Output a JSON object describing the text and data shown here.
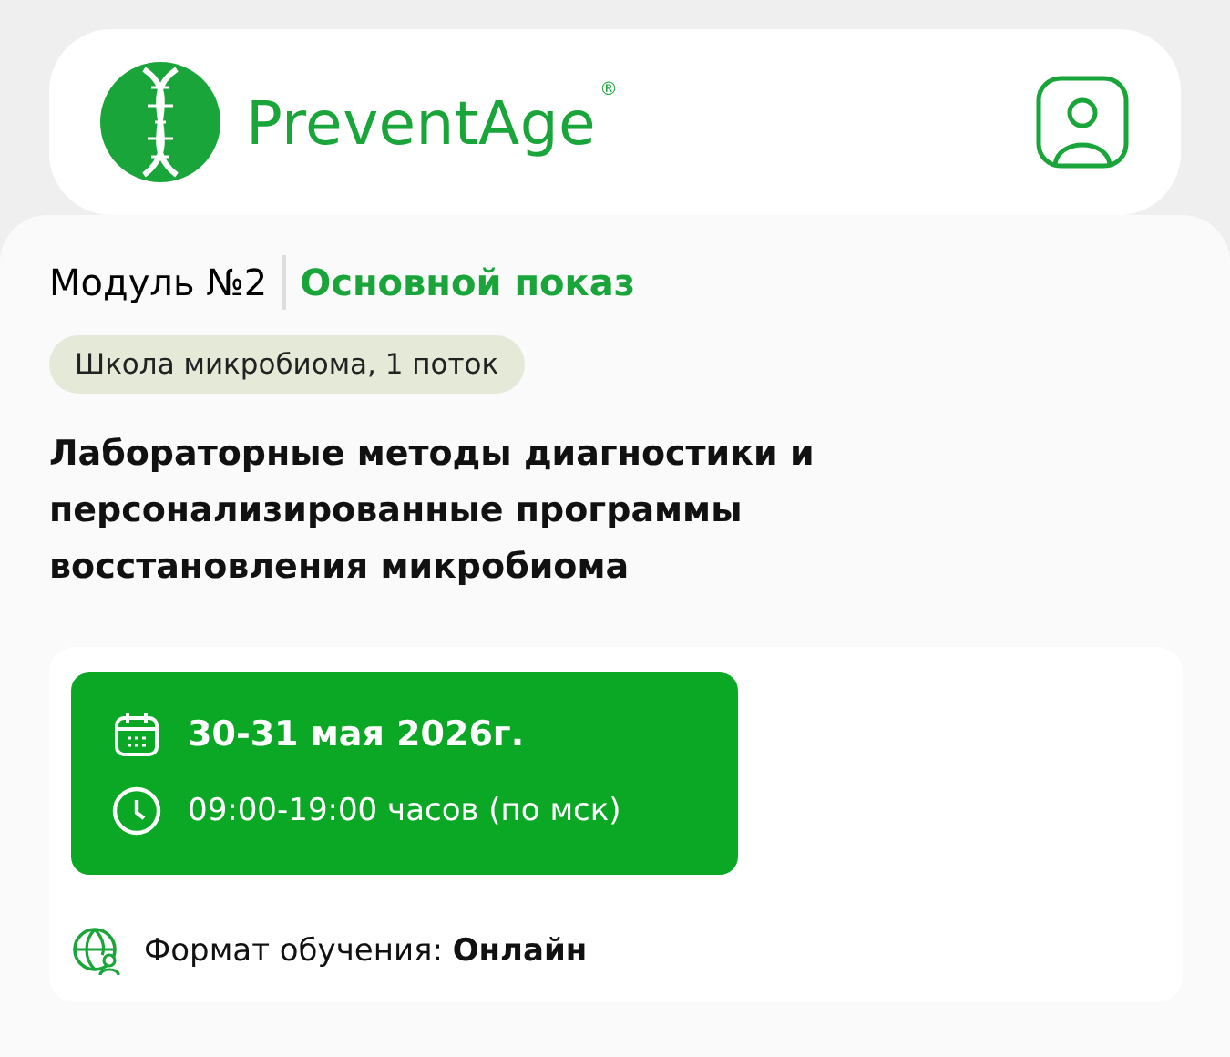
{
  "header": {
    "logo_text": "PreventAge",
    "registered_mark": "®"
  },
  "module": {
    "number": "Модуль №2",
    "show_type": "Основной показ"
  },
  "course_tag": "Школа микробиома, 1 поток",
  "title": "Лабораторные методы диагностики и персонализированные программы восстановления микробиома",
  "schedule": {
    "date": "30-31 мая 2026г.",
    "time": "09:00-19:00 часов (по мск)"
  },
  "format": "Формат обучения: **Онлайн**"
}
